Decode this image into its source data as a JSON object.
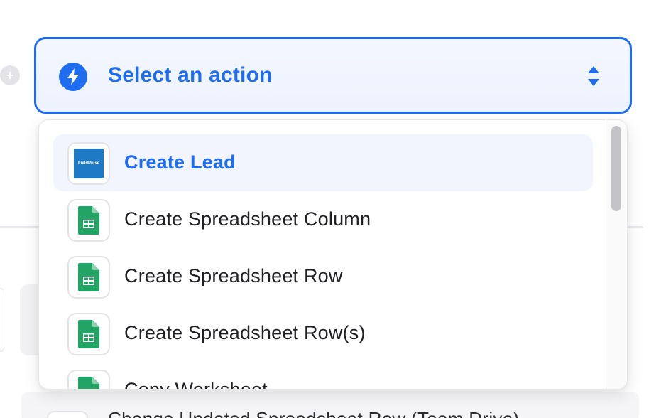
{
  "select": {
    "label": "Select an action",
    "icon": "bolt-icon"
  },
  "options": [
    {
      "label": "Create Lead",
      "app": "FieldPulse",
      "icon": "fieldpulse-logo-icon",
      "selected": true
    },
    {
      "label": "Create Spreadsheet Column",
      "app": "Google Sheets",
      "icon": "google-sheets-icon",
      "selected": false
    },
    {
      "label": "Create Spreadsheet Row",
      "app": "Google Sheets",
      "icon": "google-sheets-icon",
      "selected": false
    },
    {
      "label": "Create Spreadsheet Row(s)",
      "app": "Google Sheets",
      "icon": "google-sheets-icon",
      "selected": false
    },
    {
      "label": "Copy Worksheet",
      "app": "Google Sheets",
      "icon": "google-sheets-icon",
      "selected": false
    }
  ],
  "background": {
    "next_step_text": "Change Undated Spreadsheet Row (Team Drive)"
  },
  "colors": {
    "accent": "#1e6cf0",
    "selected_bg": "#f2f5fe",
    "sheets_green": "#21a464",
    "fieldpulse_blue": "#1e7ac4"
  }
}
